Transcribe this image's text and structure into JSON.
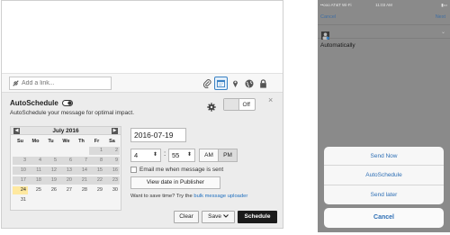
{
  "composer": {
    "link_placeholder": "Add a link...",
    "toolbar_icons": [
      "paperclip-icon",
      "calendar-icon",
      "map-pin-icon",
      "globe-icon",
      "lock-icon"
    ]
  },
  "autoschedule": {
    "title": "AutoSchedule",
    "subtitle": "AutoSchedule your message for optimal impact.",
    "toggle_label": "Off",
    "close": "×"
  },
  "calendar": {
    "month_label": "July 2016",
    "prev": "◀",
    "next": "▶",
    "weekdays": [
      "Su",
      "Mo",
      "Tu",
      "We",
      "Th",
      "Fr",
      "Sa"
    ],
    "selected_day": 24,
    "weeks": [
      [
        "",
        "",
        "",
        "",
        "",
        "1",
        "2"
      ],
      [
        "3",
        "4",
        "5",
        "6",
        "7",
        "8",
        "9"
      ],
      [
        "10",
        "11",
        "12",
        "13",
        "14",
        "15",
        "16"
      ],
      [
        "17",
        "18",
        "19",
        "20",
        "21",
        "22",
        "23"
      ],
      [
        "24",
        "25",
        "26",
        "27",
        "28",
        "29",
        "30"
      ],
      [
        "31",
        "",
        "",
        "",
        "",
        "",
        ""
      ]
    ]
  },
  "time_form": {
    "date_value": "2016-07-19",
    "hour": "4",
    "colon": ":",
    "minute": "55",
    "am_label": "AM",
    "pm_label": "PM",
    "email_label": "Email me when message is sent",
    "view_button": "View date in Publisher",
    "bulk_prefix": "Want to save time? Try the ",
    "bulk_link": "bulk message uploader"
  },
  "actions": {
    "clear": "Clear",
    "save": "Save",
    "schedule": "Schedule"
  },
  "phone": {
    "carrier": "••ooo AT&T Wi-Fi",
    "time": "11:03 AM",
    "battery": "▮▭",
    "nav_cancel": "Cancel",
    "nav_next": "Next",
    "chevron": "⌄",
    "message_text": "Automatically",
    "sheet_items": [
      "Send Now",
      "AutoSchedule",
      "Send later"
    ],
    "sheet_cancel": "Cancel"
  }
}
